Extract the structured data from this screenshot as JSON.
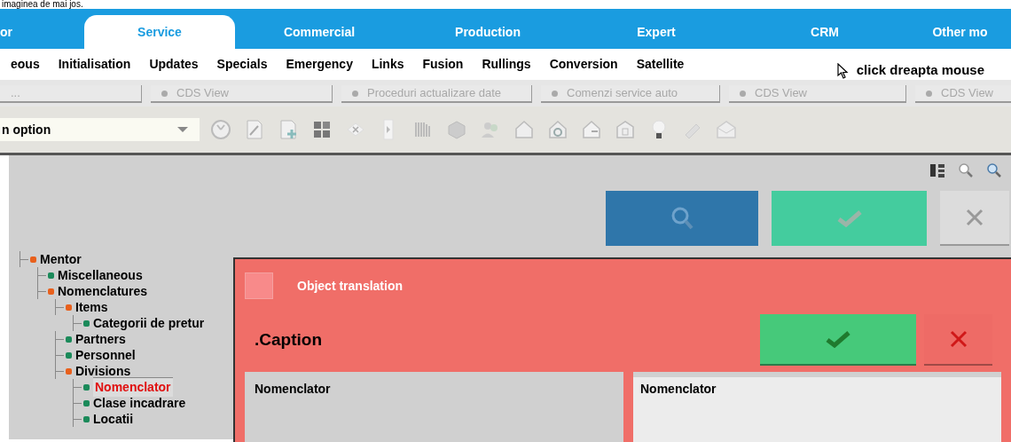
{
  "caption_line": "imaginea de mai jos.",
  "module_tabs": [
    {
      "label": "or",
      "selected": false
    },
    {
      "label": "Service",
      "selected": true
    },
    {
      "label": "Commercial",
      "selected": false
    },
    {
      "label": "Production",
      "selected": false
    },
    {
      "label": "Expert",
      "selected": false
    },
    {
      "label": "CRM",
      "selected": false
    },
    {
      "label": "Other mo",
      "selected": false
    }
  ],
  "menu": [
    "eous",
    "Initialisation",
    "Updates",
    "Specials",
    "Emergency",
    "Links",
    "Fusion",
    "Rullings",
    "Conversion",
    "Satellite"
  ],
  "hint": "click dreapta mouse",
  "view_tabs": [
    "...",
    "CDS View",
    "Proceduri actualizare date",
    "Comenzi service auto",
    "CDS View",
    "CDS View"
  ],
  "option_select": {
    "value": "n option"
  },
  "tree": [
    {
      "label": "Mentor",
      "color": "#e8601c",
      "selected": false,
      "children": [
        {
          "label": "Miscellaneous",
          "color": "#1b8a5a",
          "selected": false
        },
        {
          "label": "Nomenclatures",
          "color": "#e8601c",
          "selected": false,
          "children": [
            {
              "label": "Items",
              "color": "#e8601c",
              "selected": false,
              "children": [
                {
                  "label": "Categorii de pretur",
                  "color": "#1b8a5a",
                  "selected": false
                }
              ]
            },
            {
              "label": "Partners",
              "color": "#1b8a5a",
              "selected": false
            },
            {
              "label": "Personnel",
              "color": "#1b8a5a",
              "selected": false
            },
            {
              "label": "Divisions",
              "color": "#e8601c",
              "selected": false,
              "children": [
                {
                  "label": "Nomenclator",
                  "color": "#1b8a5a",
                  "selected": true
                },
                {
                  "label": "Clase incadrare",
                  "color": "#1b8a5a",
                  "selected": false
                },
                {
                  "label": "Locatii",
                  "color": "#1b8a5a",
                  "selected": false
                }
              ]
            }
          ]
        }
      ]
    }
  ],
  "dialog": {
    "title": "Object translation",
    "field": ".Caption",
    "panels": [
      "Nomenclator",
      "Nomenclator"
    ]
  }
}
